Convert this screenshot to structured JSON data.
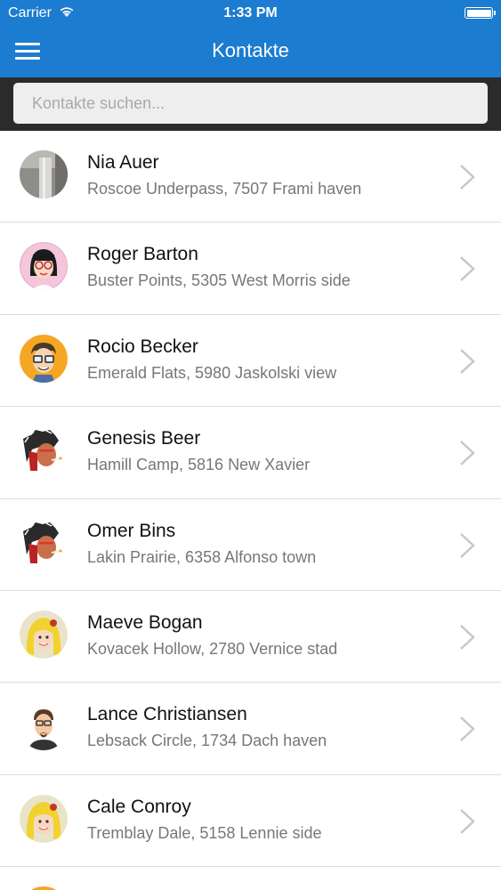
{
  "status_bar": {
    "carrier": "Carrier",
    "time": "1:33 PM"
  },
  "header": {
    "title": "Kontakte",
    "accent": "#1c7ccf"
  },
  "search": {
    "placeholder": "Kontakte suchen...",
    "value": ""
  },
  "contacts": [
    {
      "name": "Nia Auer",
      "address": "Roscoe Underpass, 7507 Frami haven",
      "avatar": "photo"
    },
    {
      "name": "Roger Barton",
      "address": "Buster Points, 5305 West Morris side",
      "avatar": "woman-glasses"
    },
    {
      "name": "Rocio Becker",
      "address": "Emerald Flats, 5980 Jaskolski view",
      "avatar": "man-glasses"
    },
    {
      "name": "Genesis Beer",
      "address": "Hamill Camp, 5816 New Xavier",
      "avatar": "headdress"
    },
    {
      "name": "Omer Bins",
      "address": "Lakin Prairie, 6358 Alfonso town",
      "avatar": "headdress"
    },
    {
      "name": "Maeve Bogan",
      "address": "Kovacek Hollow, 2780 Vernice stad",
      "avatar": "blonde-woman"
    },
    {
      "name": "Lance Christiansen",
      "address": "Lebsack Circle, 1734 Dach haven",
      "avatar": "man-goatee"
    },
    {
      "name": "Cale Conroy",
      "address": "Tremblay Dale, 5158 Lennie side",
      "avatar": "blonde-woman"
    }
  ]
}
